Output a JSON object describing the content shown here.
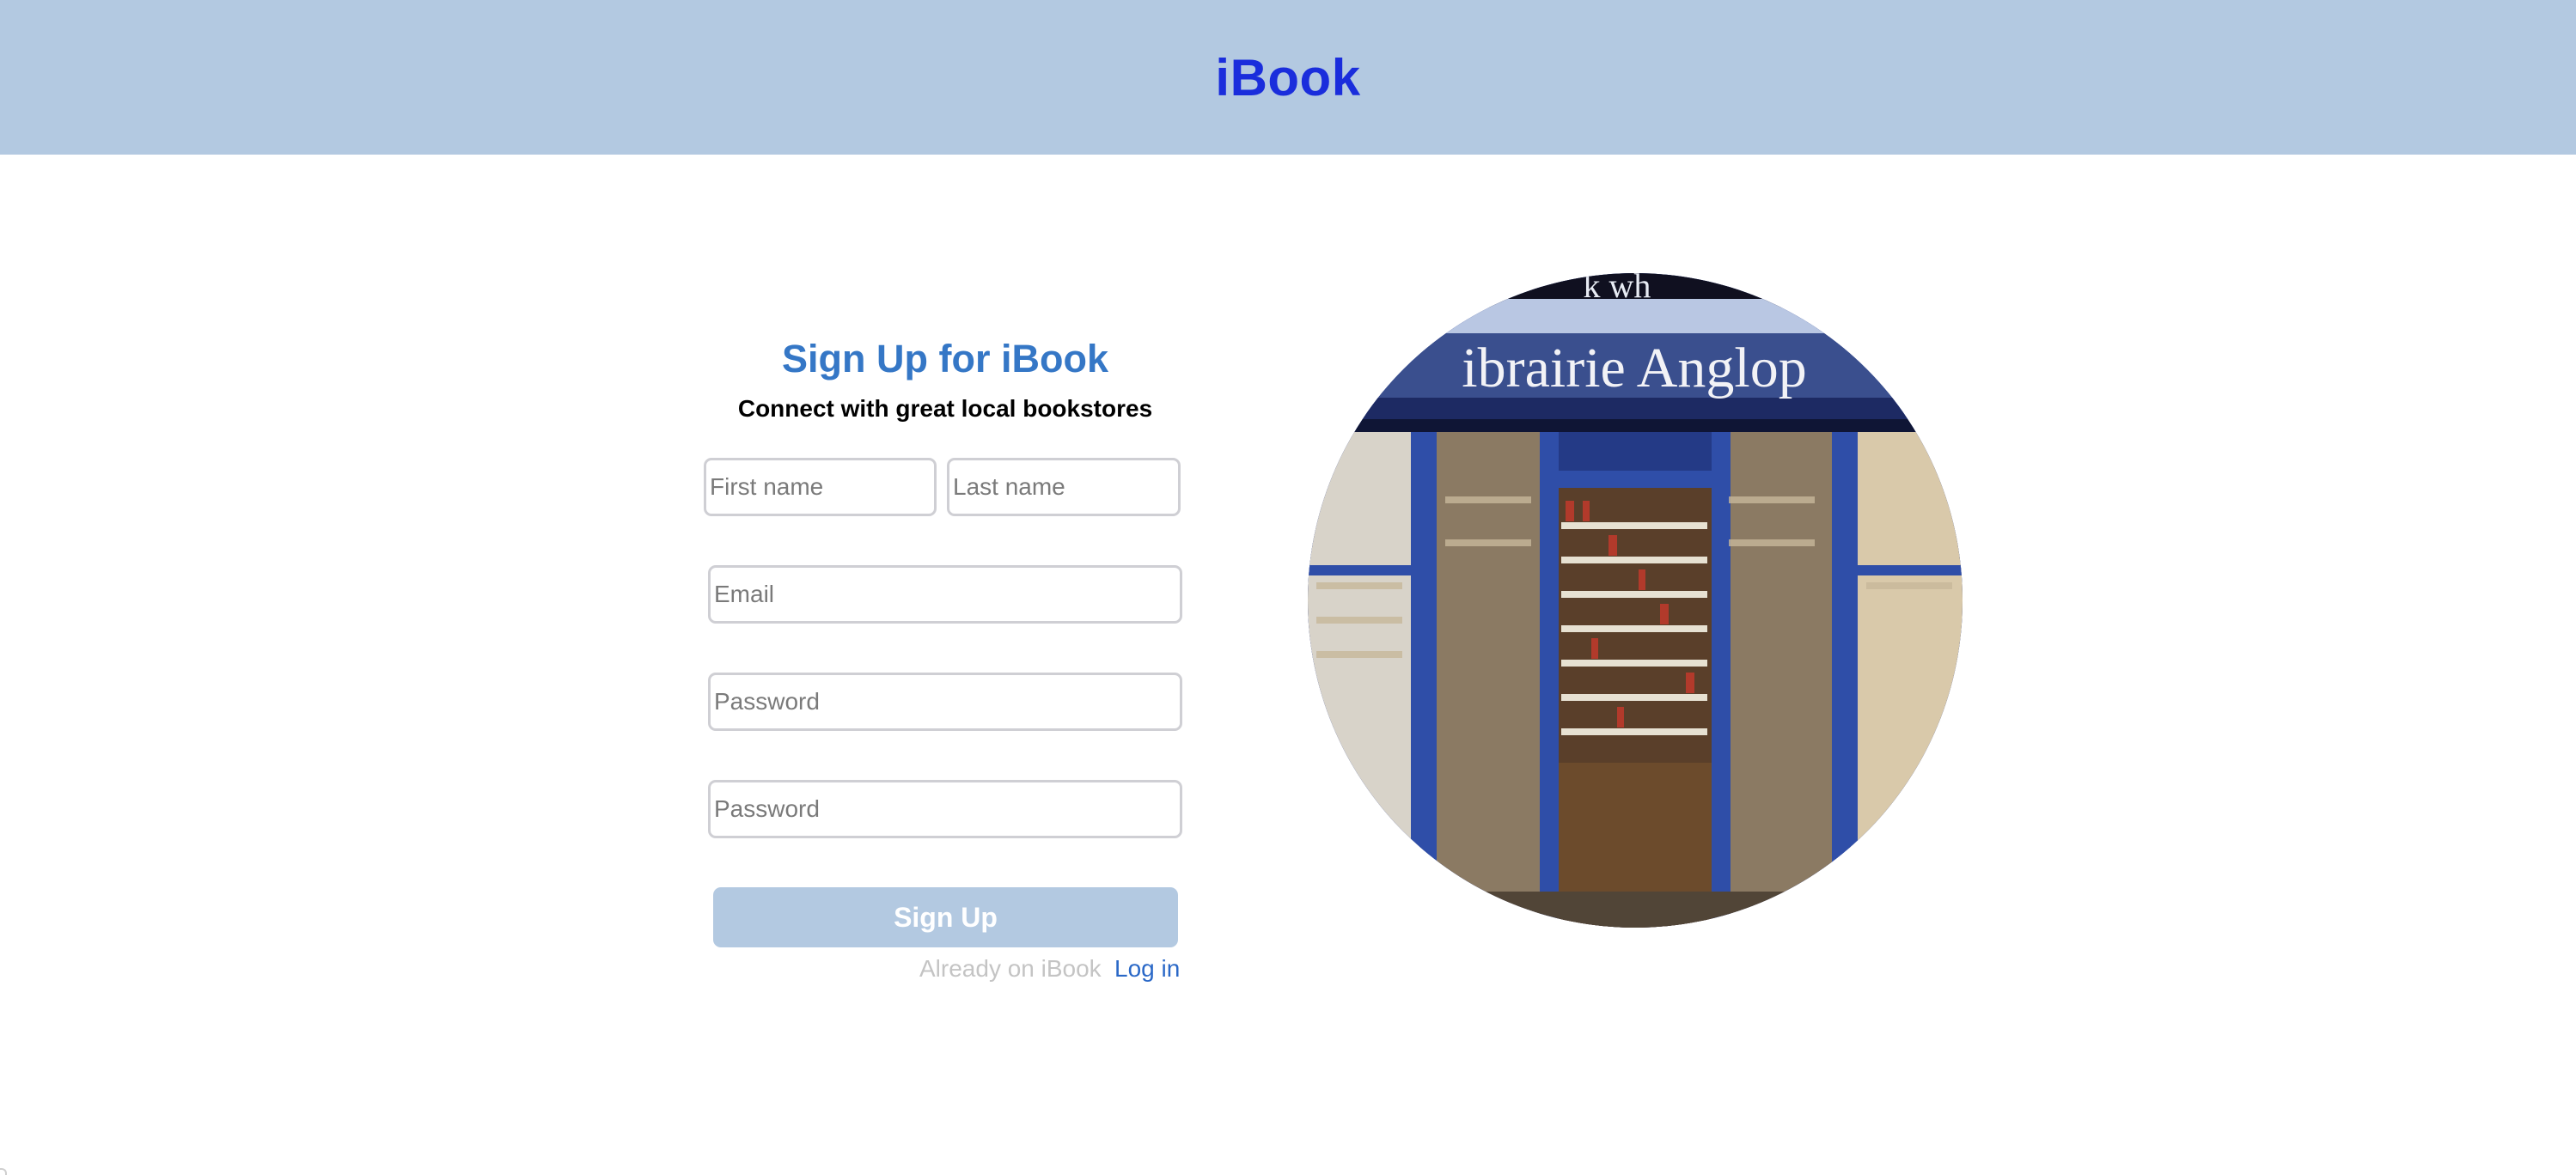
{
  "header": {
    "brand": "iBook"
  },
  "form": {
    "title": "Sign Up for iBook",
    "subtitle": "Connect with great local bookstores",
    "first_name_placeholder": "First name",
    "last_name_placeholder": "Last name",
    "email_placeholder": "Email",
    "password_placeholder": "Password",
    "confirm_password_placeholder": "Password",
    "submit_label": "Sign Up",
    "already_text": "Already on iBook",
    "login_label": "Log in"
  },
  "photo": {
    "sign_text": "ibrairie Anglop",
    "top_text": "k wh"
  },
  "colors": {
    "header_bg": "#b3c9e1",
    "brand": "#1a2ddc",
    "title": "#3577c6",
    "button_bg": "#b3c9e1",
    "link": "#2a68c7",
    "muted": "#c4c4c4"
  }
}
